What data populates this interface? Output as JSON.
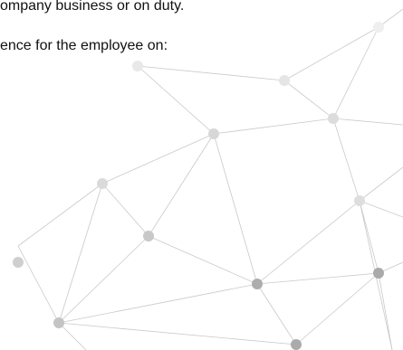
{
  "document": {
    "lines": [
      "ompany business or on duty.",
      "ence for the employee on:"
    ]
  },
  "decoration": {
    "name": "network-graph-watermark",
    "edge_color": "#c9c9c9",
    "node_colors": [
      "#e5e5e5",
      "#d3d3d3",
      "#c4c4c4",
      "#ababab"
    ]
  }
}
